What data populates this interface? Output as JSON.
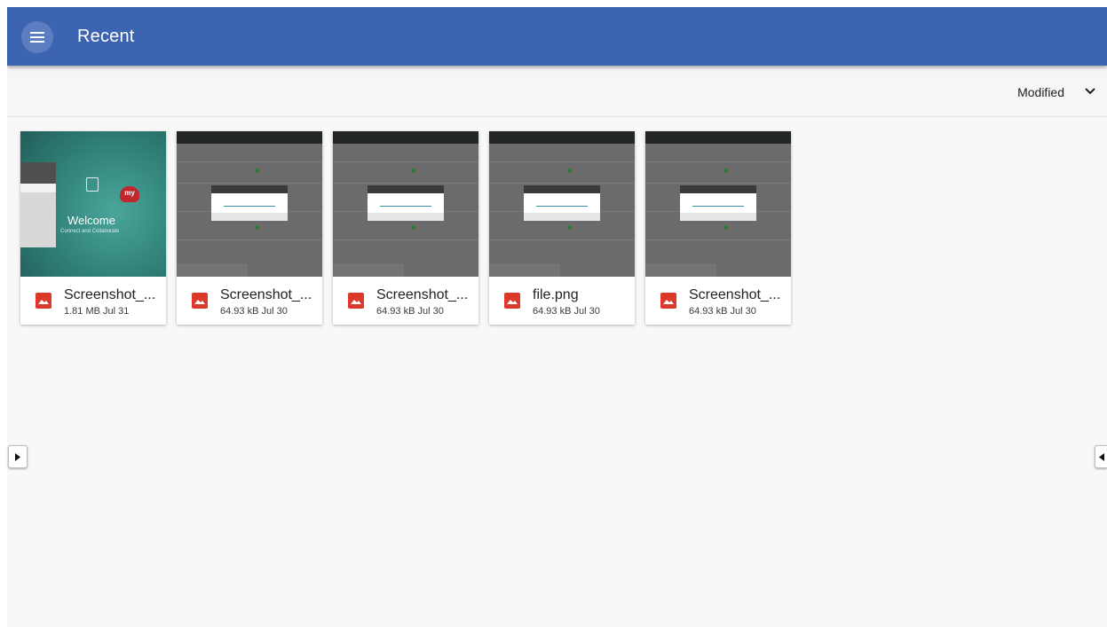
{
  "appbar": {
    "title": "Recent",
    "menu_icon": "hamburger-menu-icon",
    "color": "#3c64b1"
  },
  "sort": {
    "label": "Modified",
    "icon": "chevron-down-icon"
  },
  "files": [
    {
      "name": "Screenshot_...",
      "meta": "1.81 MB Jul 31",
      "icon": "image-file-icon",
      "thumbnail": "welcome-screen"
    },
    {
      "name": "Screenshot_...",
      "meta": "64.93 kB Jul 30",
      "icon": "image-file-icon",
      "thumbnail": "dialog-screenshot"
    },
    {
      "name": "Screenshot_...",
      "meta": "64.93 kB Jul 30",
      "icon": "image-file-icon",
      "thumbnail": "dialog-screenshot"
    },
    {
      "name": "file.png",
      "meta": "64.93 kB Jul 30",
      "icon": "image-file-icon",
      "thumbnail": "dialog-screenshot"
    },
    {
      "name": "Screenshot_...",
      "meta": "64.93 kB Jul 30",
      "icon": "image-file-icon",
      "thumbnail": "dialog-screenshot"
    }
  ],
  "welcome_thumb": {
    "heading": "Welcome",
    "subheading": "Connect and Collaborate",
    "brand": "my"
  },
  "edge_controls": {
    "left_icon": "play-right-arrow-icon",
    "right_icon": "play-left-arrow-icon"
  },
  "colors": {
    "file_icon": "#d93a2b",
    "background": "#f8f8f8"
  }
}
